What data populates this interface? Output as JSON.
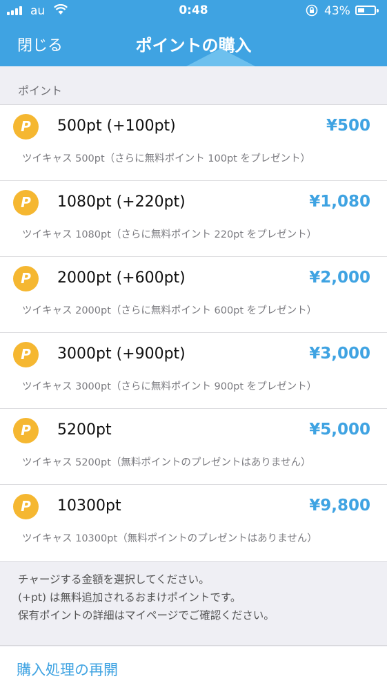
{
  "status_bar": {
    "carrier": "au",
    "time": "0:48",
    "battery_percent": "43%",
    "battery_level": 0.43,
    "icons": [
      "signal-icon",
      "wifi-icon",
      "rotation-lock-icon",
      "battery-icon"
    ]
  },
  "nav": {
    "close_label": "閉じる",
    "title": "ポイントの購入"
  },
  "section": {
    "header": "ポイント"
  },
  "items": [
    {
      "name": "500pt (+100pt)",
      "price": "¥500",
      "description": "ツイキャス 500pt（さらに無料ポイント 100pt をプレゼント）",
      "icon": "P"
    },
    {
      "name": "1080pt (+220pt)",
      "price": "¥1,080",
      "description": "ツイキャス 1080pt（さらに無料ポイント 220pt をプレゼント）",
      "icon": "P"
    },
    {
      "name": "2000pt (+600pt)",
      "price": "¥2,000",
      "description": "ツイキャス 2000pt（さらに無料ポイント 600pt をプレゼント）",
      "icon": "P"
    },
    {
      "name": "3000pt (+900pt)",
      "price": "¥3,000",
      "description": "ツイキャス 3000pt（さらに無料ポイント 900pt をプレゼント）",
      "icon": "P"
    },
    {
      "name": "5200pt",
      "price": "¥5,000",
      "description": "ツイキャス 5200pt（無料ポイントのプレゼントはありません）",
      "icon": "P"
    },
    {
      "name": "10300pt",
      "price": "¥9,800",
      "description": "ツイキャス 10300pt（無料ポイントのプレゼントはありません）",
      "icon": "P"
    }
  ],
  "notes": {
    "line1": "チャージする金額を選択してください。",
    "line2": "(+pt) は無料追加されるおまけポイントです。",
    "line3": "保有ポイントの詳細はマイページでご確認ください。"
  },
  "resume_label": "購入処理の再開",
  "colors": {
    "accent": "#3fa3e2",
    "coin": "#f5b731",
    "background": "#efeff4"
  }
}
